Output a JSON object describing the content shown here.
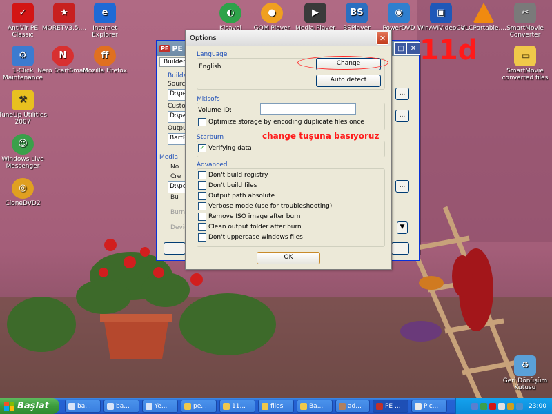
{
  "desktop_icons": [
    {
      "label": "AntiVir PE Classic",
      "icon": "antivir-icon",
      "color": "#d31515"
    },
    {
      "label": "MORETV3.5....",
      "icon": "moretv-icon",
      "color": "#c82020"
    },
    {
      "label": "Internet Explorer",
      "icon": "internet-explorer-icon",
      "color": "#1e6ad6"
    },
    {
      "label": "Kisayol",
      "icon": "shortcut-icon",
      "color": "#2ea34a"
    },
    {
      "label": "GOM Player",
      "icon": "gom-player-icon",
      "color": "#f0a020"
    },
    {
      "label": "Media Player",
      "icon": "media-player-icon",
      "color": "#3a3a3a"
    },
    {
      "label": "BSPlayer",
      "icon": "bsplayer-icon",
      "color": "#2b6fc0"
    },
    {
      "label": "PowerDVD",
      "icon": "powerdvd-icon",
      "color": "#2f7fcf"
    },
    {
      "label": "WinAVIVideoCo",
      "icon": "winavi-icon",
      "color": "#1f58b8"
    },
    {
      "label": "VLCPortable....",
      "icon": "vlc-icon",
      "color": "#f08a10"
    },
    {
      "label": "SmartMovie Converter",
      "icon": "smartmovie-icon",
      "color": "#7a7a7a"
    },
    {
      "label": "1-Click Maintenance",
      "icon": "maintenance-icon",
      "color": "#3c7bd0"
    },
    {
      "label": "Nero StartSmart",
      "icon": "nero-icon",
      "color": "#d83030"
    },
    {
      "label": "Mozilla Firefox",
      "icon": "firefox-icon",
      "color": "#e07020"
    },
    {
      "label": "SmartMovie converted files",
      "icon": "folder-icon",
      "color": "#f0c84a"
    },
    {
      "label": "TuneUp Utilities 2007",
      "icon": "tuneup-icon",
      "color": "#e8c020"
    },
    {
      "label": "Windows Live Messenger",
      "icon": "messenger-icon",
      "color": "#3aa04a"
    },
    {
      "label": "CloneDVD2",
      "icon": "clonedvd-icon",
      "color": "#e0a020"
    },
    {
      "label": "Geri Dönüşüm Kutusu",
      "icon": "recycle-bin-icon",
      "color": "#5aa0d8"
    }
  ],
  "back_window": {
    "title": "PE Bu",
    "tab": "Builder",
    "group_builder": "Builder",
    "label_source": "Source",
    "label_custom": "Custom",
    "label_output": "Output",
    "label_media": "Media",
    "field_source": "D:\\pe",
    "field_custom": "D:\\pe",
    "field_output": "BartP",
    "field_media": "D:\\pe",
    "radio_1": "No",
    "radio_2": "Cre",
    "radio_3": "Bu",
    "label_burn": "Burn",
    "label_device": "Devic"
  },
  "dialog": {
    "title": "Options",
    "language_group": "Language",
    "language_value": "English",
    "change_button": "Change",
    "auto_detect_button": "Auto detect",
    "mkisofs_group": "Mkisofs",
    "volume_id_label": "Volume ID:",
    "volume_id_value": "",
    "optimize_label": "Optimize storage by encoding duplicate files once",
    "optimize_checked": false,
    "starburn_group": "Starburn",
    "verifying_label": "Verifying data",
    "verifying_checked": true,
    "advanced_group": "Advanced",
    "advanced_options": [
      {
        "label": "Don't build registry",
        "checked": false
      },
      {
        "label": "Don't build files",
        "checked": false
      },
      {
        "label": "Output path absolute",
        "checked": false
      },
      {
        "label": "Verbose mode (use for troubleshooting)",
        "checked": false
      },
      {
        "label": "Remove ISO image after burn",
        "checked": false
      },
      {
        "label": "Clean output folder after burn",
        "checked": false
      },
      {
        "label": "Don't uppercase windows files",
        "checked": false
      }
    ],
    "ok_button": "OK"
  },
  "annotations": {
    "step": "11d",
    "note": "change tuşuna basıyoruz"
  },
  "taskbar": {
    "start_label": "Başlat",
    "tasks": [
      "ba...",
      "ba...",
      "Ye...",
      "pe...",
      "11...",
      "files",
      "Ba...",
      "ad...",
      "PE ...",
      "Pic..."
    ],
    "active_task_index": 8,
    "clock": "23:00"
  }
}
